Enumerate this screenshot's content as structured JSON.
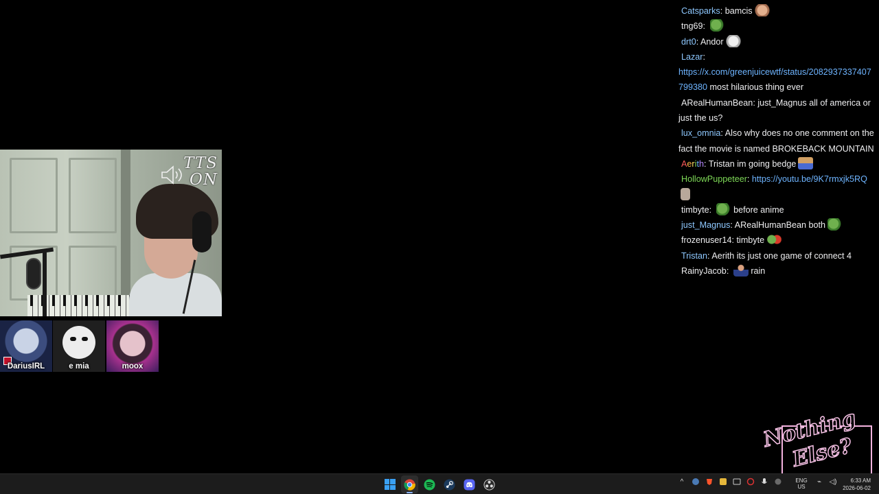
{
  "stream": {
    "tts_label": "TTS ON"
  },
  "viewers": [
    {
      "name": "DariusIRL"
    },
    {
      "name": "e mia"
    },
    {
      "name": "moox"
    }
  ],
  "chat": [
    {
      "user": "Catsparks",
      "color": "#8ec8ff",
      "parts": [
        {
          "t": "bamcis"
        }
      ],
      "emote": "hand"
    },
    {
      "user": "tng69",
      "color": "#efeff1",
      "parts": [],
      "emote": "pepe"
    },
    {
      "user": "drt0",
      "color": "#8ec8ff",
      "parts": [
        {
          "t": "Andor"
        }
      ],
      "emote": "dog"
    },
    {
      "user": "Lazar",
      "color": "#8ec8ff",
      "parts": [
        {
          "link": "https://x.com/greenjuicewtf/status/2082937337407799380"
        },
        {
          "t": " most hilarious thing ever"
        }
      ]
    },
    {
      "user": "ARealHumanBean",
      "color": "#efeff1",
      "parts": [
        {
          "t": "just_Magnus all of america or just the us?"
        }
      ]
    },
    {
      "user": "lux_omnia",
      "color": "#8ec8ff",
      "parts": [
        {
          "t": "Also why does no one comment on the fact the movie is named BROKEBACK MOUNTAIN"
        }
      ]
    },
    {
      "user": "Aerith",
      "color": "rainbow",
      "parts": [
        {
          "t": "Tristan im going bedge"
        }
      ],
      "emote": "bed"
    },
    {
      "user": "HollowPuppeteer",
      "color": "#7ed957",
      "parts": [
        {
          "link": "https://youtu.be/9K7rmxjk5RQ"
        }
      ],
      "emote": "beige"
    },
    {
      "user": "timbyte",
      "color": "#efeff1",
      "parts": [],
      "emote_mid": "pepe",
      "after": "before anime"
    },
    {
      "user": "just_Magnus",
      "color": "#8ec8ff",
      "parts": [
        {
          "t": "ARealHumanBean both"
        }
      ],
      "emote": "pepe"
    },
    {
      "user": "frozenuser14",
      "color": "#efeff1",
      "parts": [
        {
          "t": "timbyte"
        }
      ],
      "emote": "fist"
    },
    {
      "user": "Tristan",
      "color": "#8ec8ff",
      "parts": [
        {
          "t": "Aerith its just one game of connect 4"
        }
      ]
    },
    {
      "user": "RainyJacob",
      "color": "#efeff1",
      "parts": [],
      "emote_mid": "man",
      "after": "rain"
    }
  ],
  "overlay": {
    "logo_line1": "Nothing",
    "logo_line2": "Else?"
  },
  "taskbar": {
    "apps": [
      {
        "icon": "windows-start-icon"
      },
      {
        "icon": "chrome-icon",
        "active": true
      },
      {
        "icon": "spotify-icon"
      },
      {
        "icon": "steam-icon"
      },
      {
        "icon": "discord-icon"
      },
      {
        "icon": "obs-icon"
      }
    ],
    "lang_line1": "ENG",
    "lang_line2": "US",
    "time": "6:33 AM",
    "date": "2026-06-02"
  },
  "colors": {
    "link": "#6eb4ff",
    "chat_text": "#efeff1",
    "logo_pink": "#f7c2e6"
  }
}
